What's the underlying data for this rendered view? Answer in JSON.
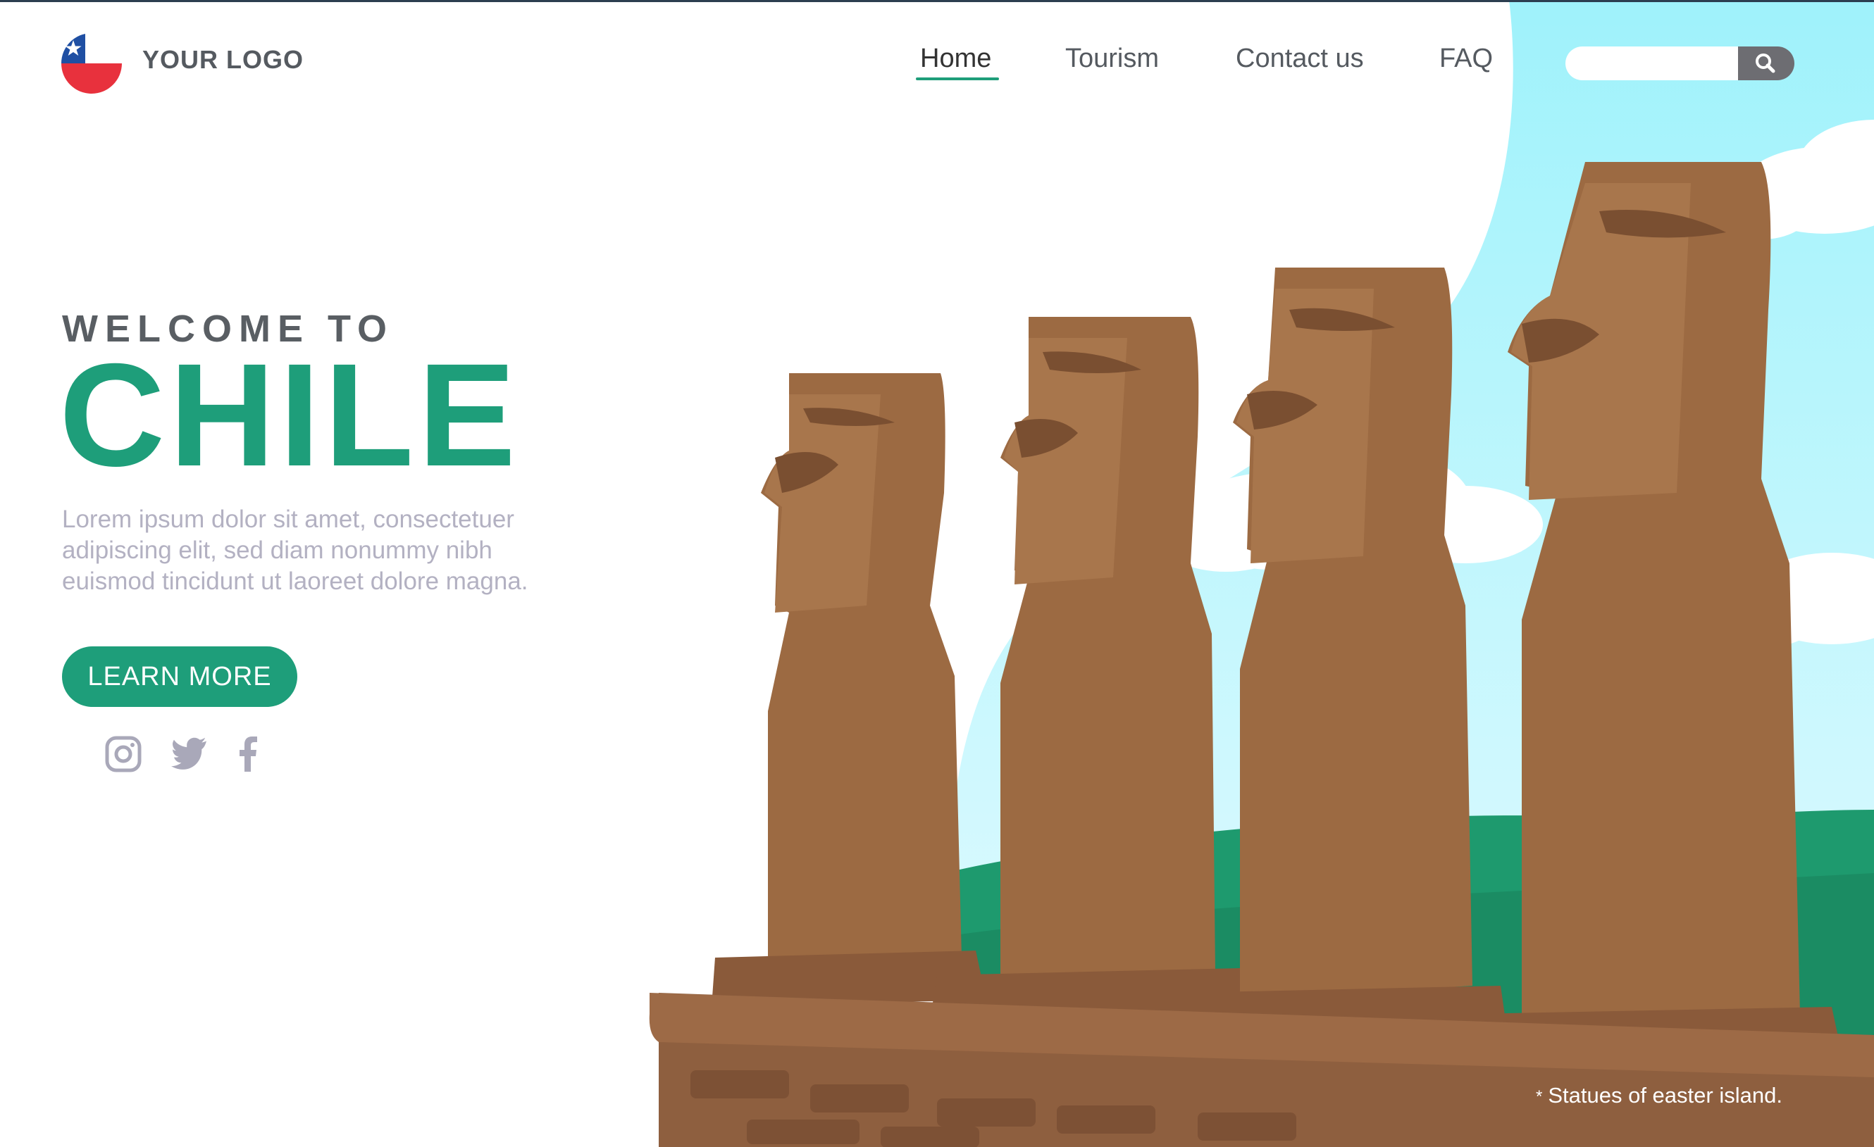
{
  "header": {
    "logo_text": "YOUR LOGO",
    "flag_colors": {
      "blue": "#1f4fa3",
      "white": "#ffffff",
      "red": "#e8313d"
    },
    "nav": [
      {
        "label": "Home",
        "active": true
      },
      {
        "label": "Tourism",
        "active": false
      },
      {
        "label": "Contact us",
        "active": false
      },
      {
        "label": "FAQ",
        "active": false
      }
    ],
    "search": {
      "placeholder": ""
    }
  },
  "hero": {
    "eyebrow": "WELCOME TO",
    "title": "CHILE",
    "body_lines": [
      "Lorem ipsum dolor sit amet, consectetuer",
      "adipiscing elit, sed diam nonummy nibh",
      "euismod tincidunt ut laoreet dolore magna."
    ],
    "cta_label": "LEARN MORE",
    "social_icons": [
      "instagram-icon",
      "twitter-icon",
      "facebook-icon"
    ]
  },
  "illustration": {
    "caption_marker": "*",
    "caption": "Statues of easter island.",
    "colors": {
      "accent": "#1e9e7a",
      "sky": "#9ff0fb",
      "hill": "#1e9a6e",
      "stone": "#9c6a42",
      "wall": "#8e5f3f"
    }
  }
}
